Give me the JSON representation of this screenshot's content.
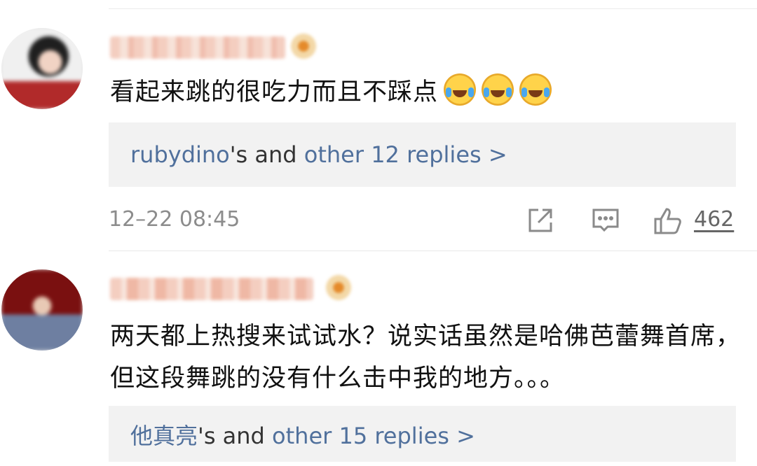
{
  "comments": [
    {
      "text": "看起来跳的很吃力而且不踩点",
      "emojis": [
        "laugh-cry-emoji",
        "laugh-cry-emoji",
        "laugh-cry-emoji"
      ],
      "replies": {
        "user": "rubydino",
        "middle": "'s and ",
        "rest": "other 12 replies >"
      },
      "time": "12–22 08:45",
      "likes": "462"
    },
    {
      "text": "两天都上热搜来试试水？说实话虽然是哈佛芭蕾舞首席，但这段舞跳的没有什么击中我的地方。。。",
      "replies": {
        "user": "他真亮",
        "middle": "'s and ",
        "rest": "other 15 replies >"
      }
    }
  ],
  "icons": {
    "share": "share-icon",
    "comment": "comment-icon",
    "like": "thumbs-up-icon"
  },
  "colors": {
    "link": "#50709c",
    "reply_bg": "#f2f2f2",
    "meta": "#8c8c8c"
  }
}
